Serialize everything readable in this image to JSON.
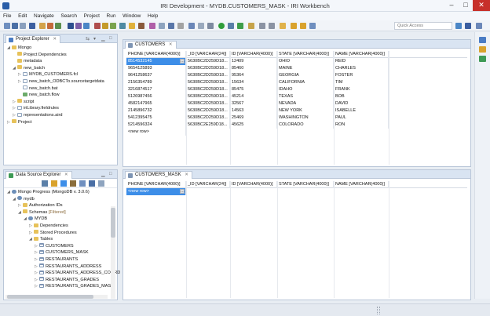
{
  "window": {
    "title": "IRI Development - MYDB.CUSTOMERS_MASK - IRI Workbench",
    "minimize": "–",
    "maximize": "□",
    "close": "✕"
  },
  "menu": [
    "File",
    "Edit",
    "Navigate",
    "Search",
    "Project",
    "Run",
    "Window",
    "Help"
  ],
  "toolbar": {
    "quick_access_placeholder": "Quick Access"
  },
  "project_explorer": {
    "tab_label": "Project Explorer",
    "tree": [
      {
        "label": "Mongo",
        "icon": "folder",
        "depth": 0,
        "arrow": "◢"
      },
      {
        "label": "Project Dependencies",
        "icon": "folder",
        "depth": 1,
        "arrow": ""
      },
      {
        "label": "metadata",
        "icon": "folder",
        "depth": 1,
        "arrow": ""
      },
      {
        "label": "new_batch",
        "icon": "folder",
        "depth": 1,
        "arrow": "◢"
      },
      {
        "label": "MYDB_CUSTOMERS.fcl",
        "icon": "file",
        "depth": 2,
        "arrow": "▷"
      },
      {
        "label": "new_batch_ODBCTo.sourcetargetdata",
        "icon": "file",
        "depth": 2,
        "arrow": "▷"
      },
      {
        "label": "new_batch.bat",
        "icon": "file",
        "depth": 2,
        "arrow": ""
      },
      {
        "label": "new_batch.flow",
        "icon": "flow",
        "depth": 2,
        "arrow": ""
      },
      {
        "label": "script",
        "icon": "folder",
        "depth": 1,
        "arrow": "▷"
      },
      {
        "label": "iriLibrary.fieldrules",
        "icon": "file",
        "depth": 1,
        "arrow": "▷"
      },
      {
        "label": "representations.aird",
        "icon": "file",
        "depth": 1,
        "arrow": "▷"
      },
      {
        "label": "Project",
        "icon": "folder",
        "depth": 0,
        "arrow": "▷"
      }
    ]
  },
  "data_source_explorer": {
    "tab_label": "Data Source Explorer",
    "tree": [
      {
        "label": "Mongo Progress (MongoDB v. 3.0.6)",
        "icon": "db",
        "depth": 0,
        "arrow": "◢"
      },
      {
        "label": "mydb",
        "icon": "db",
        "depth": 1,
        "arrow": "◢"
      },
      {
        "label": "Authorization IDs",
        "icon": "folder",
        "depth": 2,
        "arrow": "▷"
      },
      {
        "label": "Schemas",
        "icon": "folder",
        "depth": 2,
        "arrow": "◢",
        "suffix": "[Filtered]"
      },
      {
        "label": "MYDB",
        "icon": "db",
        "depth": 3,
        "arrow": "◢"
      },
      {
        "label": "Dependencies",
        "icon": "folder",
        "depth": 4,
        "arrow": "▷"
      },
      {
        "label": "Stored Procedures",
        "icon": "folder",
        "depth": 4,
        "arrow": "▷"
      },
      {
        "label": "Tables",
        "icon": "folder",
        "depth": 4,
        "arrow": "◢"
      },
      {
        "label": "CUSTOMERS",
        "icon": "table",
        "depth": 5,
        "arrow": "▷"
      },
      {
        "label": "CUSTOMERS_MASK",
        "icon": "table",
        "depth": 5,
        "arrow": "▷"
      },
      {
        "label": "RESTAURANTS",
        "icon": "table",
        "depth": 5,
        "arrow": "▷"
      },
      {
        "label": "RESTAURANTS_ADDRESS",
        "icon": "table",
        "depth": 5,
        "arrow": "▷"
      },
      {
        "label": "RESTAURANTS_ADDRESS_COORD",
        "icon": "table",
        "depth": 5,
        "arrow": "▷"
      },
      {
        "label": "RESTAURANTS_GRADES",
        "icon": "table",
        "depth": 5,
        "arrow": "▷"
      },
      {
        "label": "RESTAURANTS_GRADES_MASK",
        "icon": "table",
        "depth": 5,
        "arrow": "▷"
      }
    ]
  },
  "customers_editor": {
    "tab_label": "CUSTOMERS",
    "columns": [
      "PHONE [VARCHAR(4000)]",
      "_ID [VARCHAR(24)]",
      "ID [VARCHAR(4000)]",
      "STATE [VARCHAR(4000)]",
      "NAME [VARCHAR(4000)]"
    ],
    "rows": [
      [
        "8514532145",
        "5630BC2D259D18...",
        "12409",
        "OHIO",
        "REID"
      ],
      [
        "9654125893",
        "5630BC2D259D18...",
        "85460",
        "MAINE",
        "CHARLES"
      ],
      [
        "9641258637",
        "5630BC2D259D18...",
        "95364",
        "GEORGIA",
        "FOSTER"
      ],
      [
        "2156354789",
        "5630BC2D259D18...",
        "15634",
        "CALIFORNIA",
        "TIM"
      ],
      [
        "3216874517",
        "5630BC2D259D18...",
        "85475",
        "IDAHO",
        "FRANK"
      ],
      [
        "5126987456",
        "5630BC2D259D18...",
        "45214",
        "TEXAS",
        "BOB"
      ],
      [
        "4582147965",
        "5630BC2D259D18...",
        "32567",
        "NEVADA",
        "DAVID"
      ],
      [
        "2145896732",
        "5630BC2D259D18...",
        "14563",
        "NEW YORK",
        "ISABELLE"
      ],
      [
        "5412395475",
        "5630BC2D259D18...",
        "25469",
        "WASHINGTON",
        "PAUL"
      ],
      [
        "5214596324",
        "5630BC2E259D18...",
        "45625",
        "COLORADO",
        "RON"
      ]
    ],
    "new_row": "<new row>"
  },
  "mask_editor": {
    "tab_label": "CUSTOMERS_MASK",
    "columns": [
      "PHONE [VARCHAR(4000)]",
      "_ID [VARCHAR(24)]",
      "ID [VARCHAR(4000)]",
      "STATE [VARCHAR(4000)]",
      "NAME [VARCHAR(4000)]"
    ],
    "new_row": "<new row>"
  }
}
